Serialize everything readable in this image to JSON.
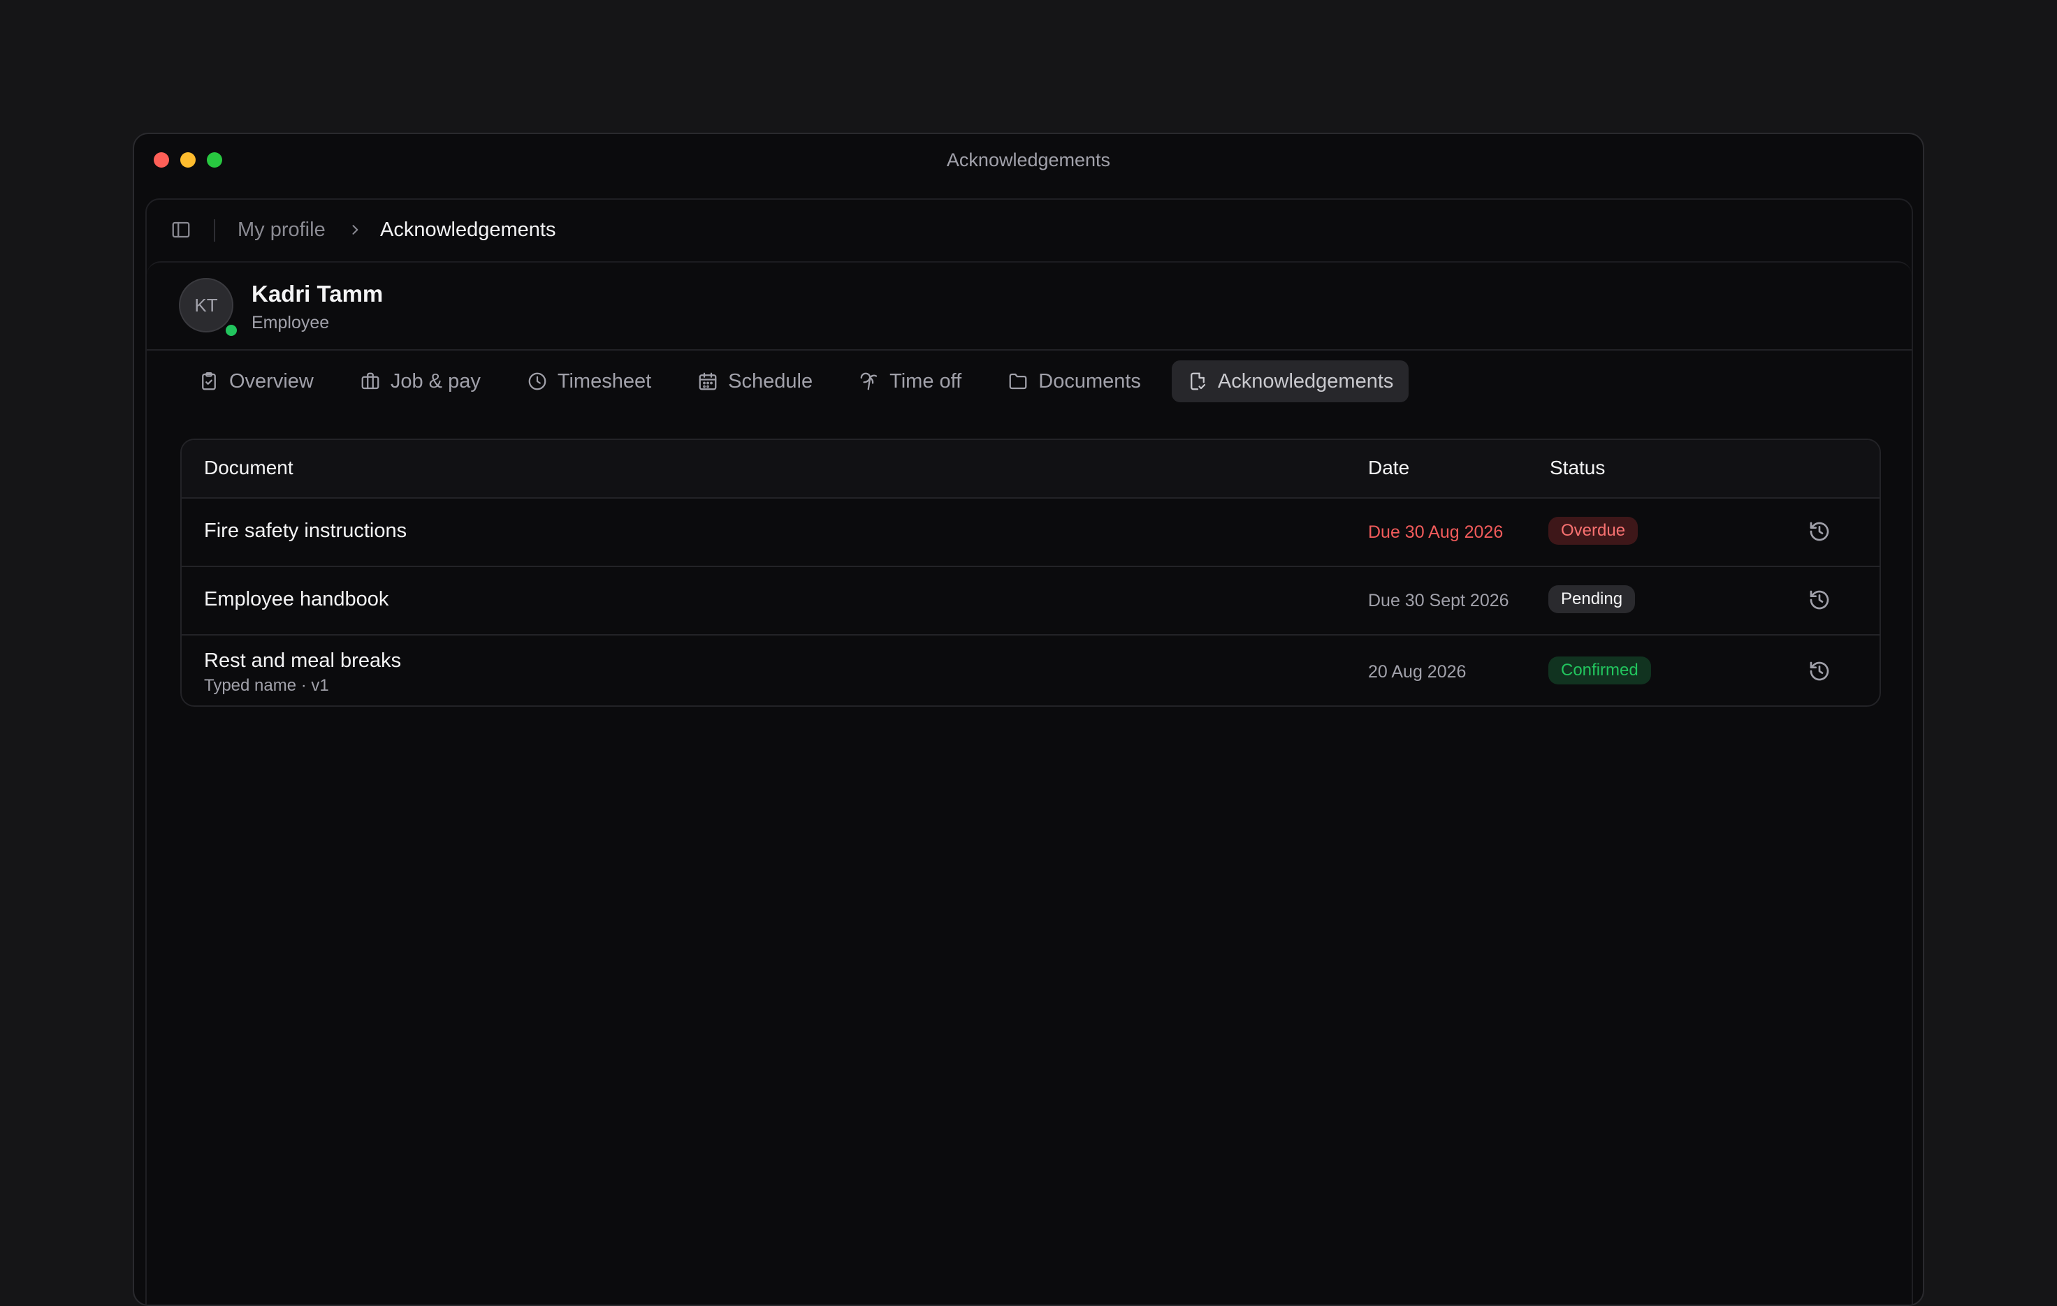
{
  "window": {
    "title": "Acknowledgements"
  },
  "breadcrumb": {
    "parent": "My profile",
    "current": "Acknowledgements"
  },
  "profile": {
    "initials": "KT",
    "name": "Kadri Tamm",
    "role": "Employee",
    "online": true
  },
  "tabs": [
    {
      "label": "Overview",
      "icon": "clipboard-check-icon"
    },
    {
      "label": "Job & pay",
      "icon": "briefcase-icon"
    },
    {
      "label": "Timesheet",
      "icon": "clock-icon"
    },
    {
      "label": "Schedule",
      "icon": "calendar-icon"
    },
    {
      "label": "Time off",
      "icon": "palm-tree-icon"
    },
    {
      "label": "Documents",
      "icon": "folder-icon"
    },
    {
      "label": "Acknowledgements",
      "icon": "file-check-icon",
      "active": true
    }
  ],
  "table": {
    "headers": {
      "document": "Document",
      "date": "Date",
      "status": "Status"
    },
    "rows": [
      {
        "title": "Fire safety instructions",
        "subtitle": "",
        "date": "Due 30 Aug 2026",
        "status": "Overdue",
        "status_color": "#f87171",
        "action_icon": "history-icon"
      },
      {
        "title": "Employee handbook",
        "subtitle": "",
        "date": "Due 30 Sept 2026",
        "status": "Pending",
        "status_color": "#f4f4f5",
        "action_icon": "history-icon"
      },
      {
        "title": "Rest and meal breaks",
        "subtitle": "Typed name · v1",
        "date": "20 Aug 2026",
        "status": "Confirmed",
        "status_color": "#22c55e",
        "action_icon": "history-icon"
      }
    ]
  }
}
